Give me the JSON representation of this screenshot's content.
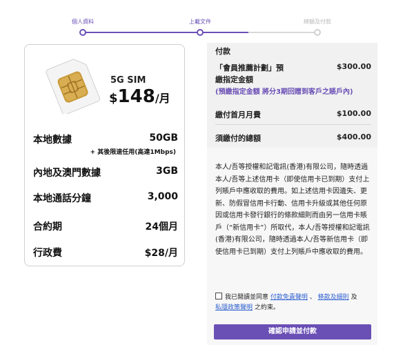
{
  "stepper": {
    "steps": [
      {
        "label": "個人資料",
        "state": "done"
      },
      {
        "label": "上載文件",
        "state": "current"
      },
      {
        "label": "總額及付款",
        "state": "todo"
      }
    ]
  },
  "plan": {
    "name": "5G SIM",
    "price_currency": "$",
    "price_amount": "148",
    "price_unit": "/月",
    "rows": [
      {
        "label": "本地數據",
        "value": "50GB"
      },
      {
        "label": "內地及澳門數據",
        "value": "3GB"
      },
      {
        "label": "本地通話分鐘",
        "value": "3,000"
      },
      {
        "label": "合約期",
        "value": "24個月"
      },
      {
        "label": "行政費",
        "value": "$28/月"
      }
    ],
    "data_note": "+ 其後限速任用(高達1Mbps)"
  },
  "payment": {
    "title": "付款",
    "referral_label_1": "「會員推薦計劃」預",
    "referral_label_2": "繳指定金額",
    "referral_value": "$300.00",
    "referral_note": "(預繳指定金額 將分3期回贈到客戶之賬戶內)",
    "first_month_label": "繳付首月月費",
    "first_month_value": "$100.00",
    "total_label": "須繳付的總額",
    "total_value": "$400.00"
  },
  "terms": {
    "text": "本人/吾等授權和記電訊(香港)有限公司，隨時透過本人/吾等上述信用卡（即使信用卡已到期）支付上列賬戶中應收取的費用。如上述信用卡因遺失、更新、防假冒信用卡行動、信用卡升級或其他任何原因或信用卡發行銀行的條款細則而由另一信用卡賬戶（“新信用卡”）所取代，本人/吾等授權和記電訊(香港)有限公司，隨時透過本人/吾等新信用卡（即使信用卡已到期）支付上列賬戶中應收取的費用。",
    "agree_prefix": "我已閱讀並同意",
    "link_disclaimer": "付款免責聲明",
    "sep1": "、",
    "link_terms": "條款及細則",
    "sep2": "及",
    "link_privacy": "私隱政策聲明",
    "agree_suffix": "之約束。"
  },
  "submit": {
    "label": "確認申請並付款"
  },
  "colors": {
    "accent": "#6a4fb5",
    "link": "#2d5fcf"
  }
}
